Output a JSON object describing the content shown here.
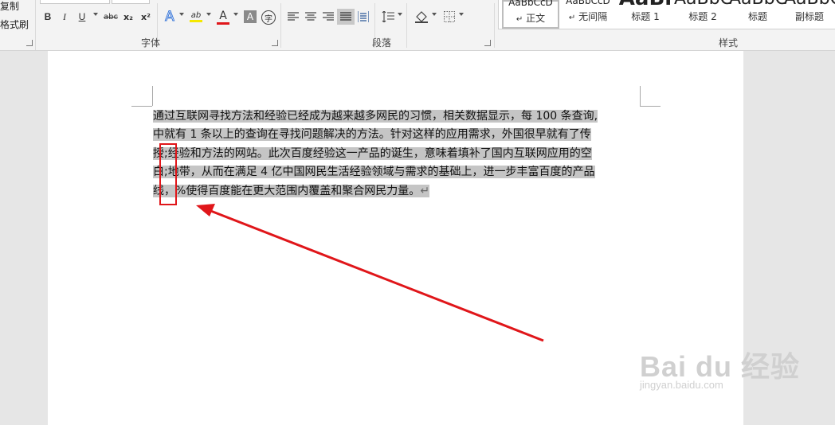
{
  "clipboard": {
    "copy": "复制",
    "format_painter": "格式刷"
  },
  "groups": {
    "font": "字体",
    "paragraph": "段落",
    "styles": "样式"
  },
  "font_buttons": {
    "bold": "B",
    "italic": "I",
    "underline": "U",
    "strikethrough": "abc",
    "subscript": "x₂",
    "superscript": "x²",
    "text_effects": "A",
    "highlight": "ab",
    "font_color": "A",
    "char_shading": "A",
    "enclose": "字"
  },
  "colors": {
    "highlight": "#f5e800",
    "font_color": "#e0161a",
    "selection": "#c5c5c5",
    "annotation": "#e0161a"
  },
  "styles": [
    {
      "preview": "AaBbCcD",
      "name": "正文",
      "marker": "↵",
      "selected": true
    },
    {
      "preview": "AaBbCcD",
      "name": "无间隔",
      "marker": "↵"
    },
    {
      "preview": "AaBl",
      "name": "标题 1"
    },
    {
      "preview": "AaBbC",
      "name": "标题 2"
    },
    {
      "preview": "AaBbC",
      "name": "标题"
    },
    {
      "preview": "AaBbC",
      "name": "副标题"
    }
  ],
  "document": {
    "lines": [
      "通过互联网寻找方法和经验已经成为越来越多网民的习惯，相关数据显示，每 100 条查询,",
      "中就有  1  条以上的查询在寻找问题解决的方法。针对这样的应用需求，外国很早就有了传",
      "授;经验和方法的网站。此次百度经验这一产品的诞生，意味着填补了国内互联网应用的空",
      "白;地带，从而在满足 4 亿中国网民生活经验领域与需求的基础上，进一步丰富百度的产品",
      "线，%使得百度能在更大范围内覆盖和聚合网民力量。"
    ],
    "pilcrow": "↵"
  },
  "watermark": {
    "brand": "Bai du 经验",
    "url": "jingyan.baidu.com"
  }
}
